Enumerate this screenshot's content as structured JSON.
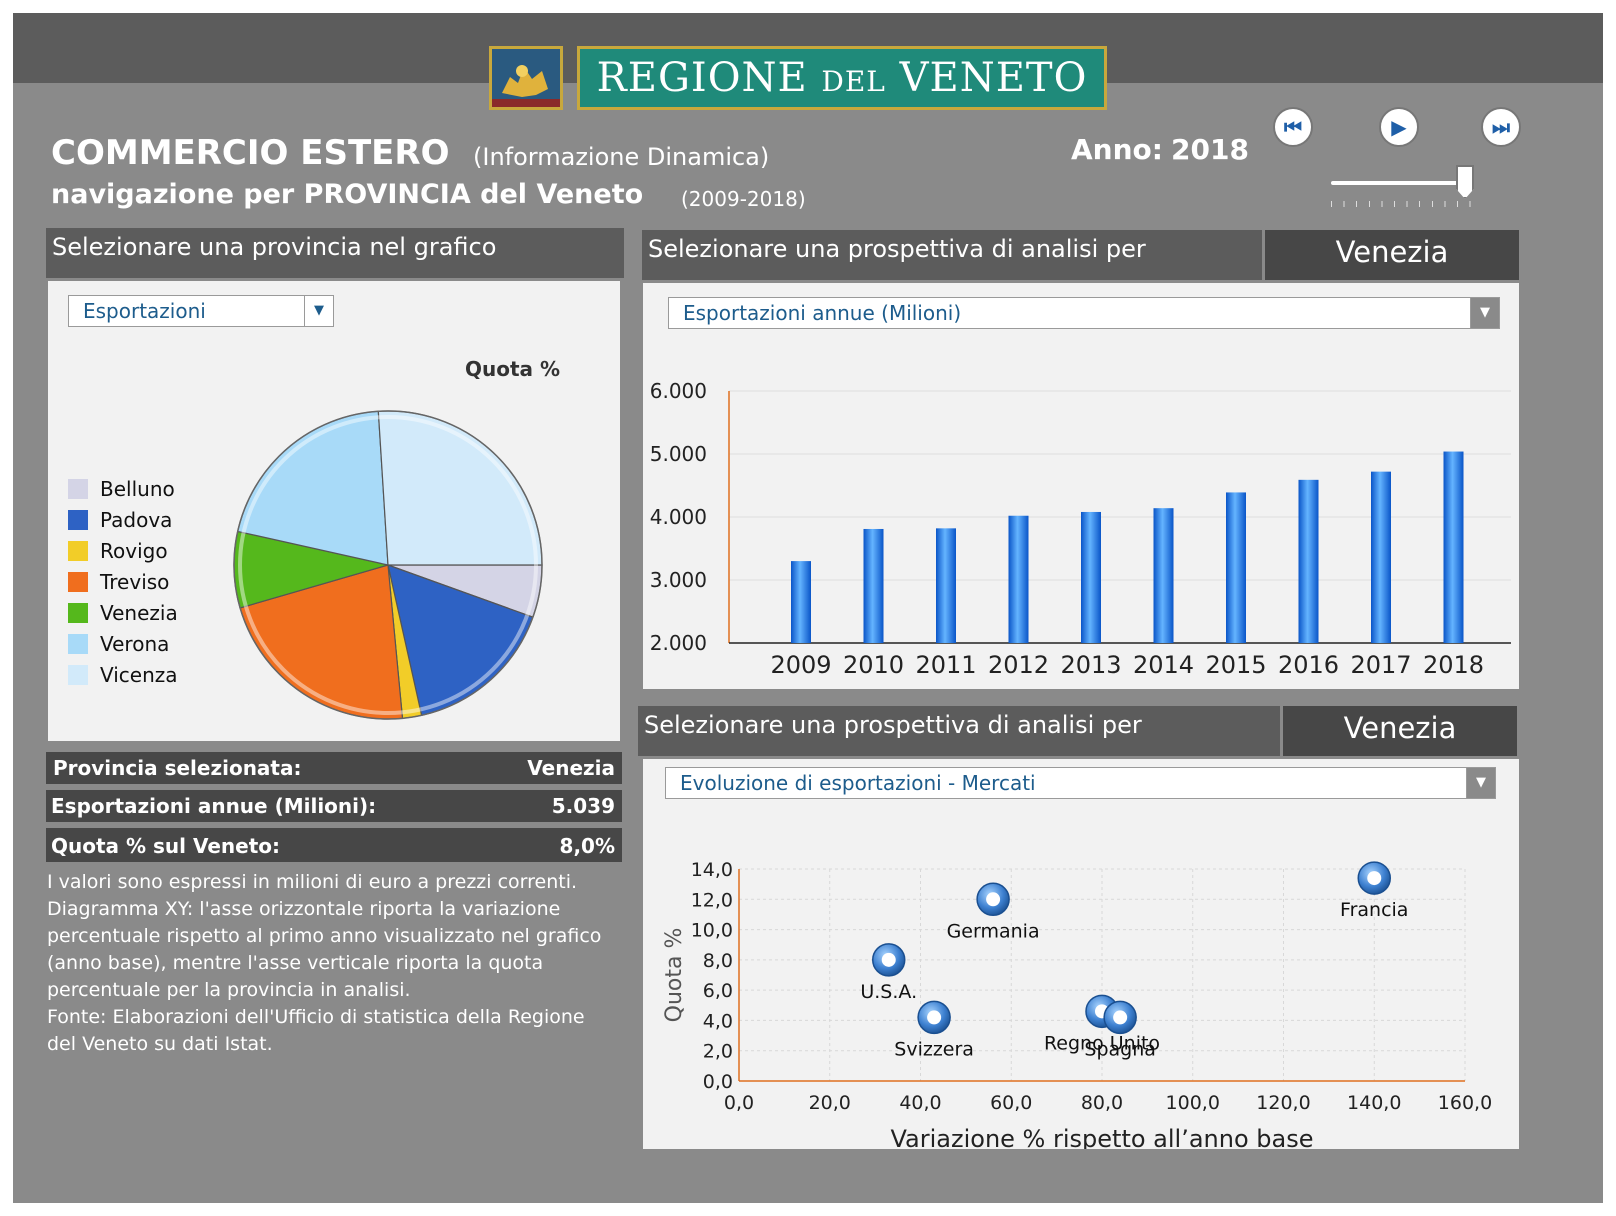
{
  "logo": {
    "text_big": "REGIONE",
    "text_small": "DEL",
    "text_big2": "VENETO"
  },
  "header": {
    "title": "COMMERCIO ESTERO",
    "subtitle": "(Informazione Dinamica)",
    "nav": "navigazione per PROVINCIA del Veneto",
    "range": "(2009-2018)",
    "year_label": "Anno:",
    "year_value": "2018"
  },
  "player": {
    "prev_icon": "skip-back-icon",
    "play_icon": "play-icon",
    "next_icon": "skip-forward-icon",
    "slider_fraction": 1.0
  },
  "left_panel": {
    "header": "Selezionare una provincia nel grafico",
    "dropdown_value": "Esportazioni",
    "pie_title": "Quota %",
    "legend": [
      {
        "label": "Belluno",
        "color": "#d4d4e6"
      },
      {
        "label": "Padova",
        "color": "#2e62c4"
      },
      {
        "label": "Rovigo",
        "color": "#f2cd28"
      },
      {
        "label": "Treviso",
        "color": "#f06e1e"
      },
      {
        "label": "Venezia",
        "color": "#55b81c"
      },
      {
        "label": "Verona",
        "color": "#a8daf8"
      },
      {
        "label": "Vicenza",
        "color": "#d2eafa"
      }
    ],
    "info": {
      "provincia_label": "Provincia selezionata:",
      "provincia_value": "Venezia",
      "export_label": "Esportazioni annue (Milioni):",
      "export_value": "5.039",
      "quota_label": "Quota % sul Veneto:",
      "quota_value": "8,0%"
    },
    "notes": "I valori sono espressi in milioni di euro a prezzi correnti.\nDiagramma XY: l'asse orizzontale riporta la variazione\npercentuale rispetto al primo anno visualizzato nel grafico\n(anno base), mentre l'asse verticale riporta la quota\npercentuale per la provincia in analisi.\nFonte: Elaborazioni dell'Ufficio di statistica della Regione\ndel Veneto su dati Istat."
  },
  "top_right": {
    "header": "Selezionare una prospettiva di analisi per",
    "province": "Venezia",
    "dropdown_value": "Esportazioni annue (Milioni)"
  },
  "bottom_right": {
    "header": "Selezionare una prospettiva di analisi per",
    "province": "Venezia",
    "dropdown_value": "Evoluzione di esportazioni - Mercati"
  },
  "chart_data": [
    {
      "type": "pie",
      "title": "Quota %",
      "series": [
        {
          "name": "Belluno",
          "value": 5.5,
          "color": "#d4d4e6"
        },
        {
          "name": "Padova",
          "value": 16.0,
          "color": "#2e62c4"
        },
        {
          "name": "Rovigo",
          "value": 2.0,
          "color": "#f2cd28"
        },
        {
          "name": "Treviso",
          "value": 22.0,
          "color": "#f06e1e"
        },
        {
          "name": "Venezia",
          "value": 8.0,
          "color": "#55b81c"
        },
        {
          "name": "Verona",
          "value": 20.5,
          "color": "#a8daf8"
        },
        {
          "name": "Vicenza",
          "value": 26.0,
          "color": "#d2eafa"
        }
      ]
    },
    {
      "type": "bar",
      "categories": [
        "2009",
        "2010",
        "2011",
        "2012",
        "2013",
        "2014",
        "2015",
        "2016",
        "2017",
        "2018"
      ],
      "values": [
        3300,
        3810,
        3820,
        4020,
        4080,
        4140,
        4390,
        4590,
        4720,
        5039
      ],
      "ylim": [
        2000,
        6000
      ],
      "yticks": [
        "2.000",
        "3.000",
        "4.000",
        "5.000",
        "6.000"
      ],
      "color": "#1a78e6"
    },
    {
      "type": "scatter",
      "xlabel": "Variazione % rispetto all’anno base",
      "ylabel": "Quota %",
      "xlim": [
        0,
        160
      ],
      "ylim": [
        0,
        14
      ],
      "xticks": [
        "0,0",
        "20,0",
        "40,0",
        "60,0",
        "80,0",
        "100,0",
        "120,0",
        "140,0",
        "160,0"
      ],
      "yticks": [
        "0,0",
        "2,0",
        "4,0",
        "6,0",
        "8,0",
        "10,0",
        "12,0",
        "14,0"
      ],
      "points": [
        {
          "label": "Francia",
          "x": 140,
          "y": 13.4
        },
        {
          "label": "Germania",
          "x": 56,
          "y": 12.0
        },
        {
          "label": "U.S.A.",
          "x": 33,
          "y": 8.0
        },
        {
          "label": "Svizzera",
          "x": 43,
          "y": 4.2
        },
        {
          "label": "Regno Unito",
          "x": 80,
          "y": 4.6
        },
        {
          "label": "Spagna",
          "x": 84,
          "y": 4.2
        }
      ]
    }
  ]
}
